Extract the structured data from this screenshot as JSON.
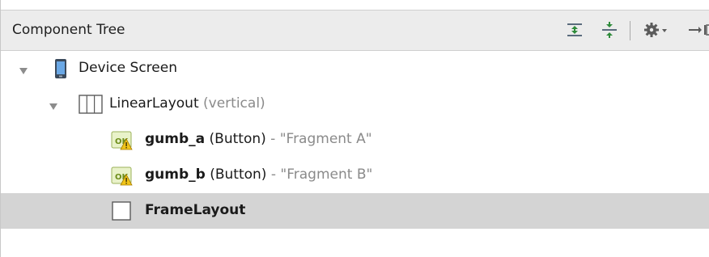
{
  "panel": {
    "title": "Component Tree",
    "toolbar": {
      "expand_all_icon": "expand-all-icon",
      "collapse_all_icon": "collapse-all-icon",
      "settings_icon": "gear-icon",
      "hide_icon": "hide-panel-icon"
    }
  },
  "tree": {
    "device": {
      "label": "Device Screen",
      "icon": "device-icon"
    },
    "linear": {
      "label": "LinearLayout",
      "suffix": "(vertical)",
      "icon": "linear-layout-icon"
    },
    "gumb_a": {
      "id": "gumb_a",
      "type": "(Button)",
      "text": "- \"Fragment A\"",
      "icon": "ok-button-warning-icon"
    },
    "gumb_b": {
      "id": "gumb_b",
      "type": "(Button)",
      "text": "- \"Fragment B\"",
      "icon": "ok-button-warning-icon"
    },
    "frame": {
      "label": "FrameLayout",
      "icon": "frame-layout-icon",
      "selected": true
    }
  }
}
